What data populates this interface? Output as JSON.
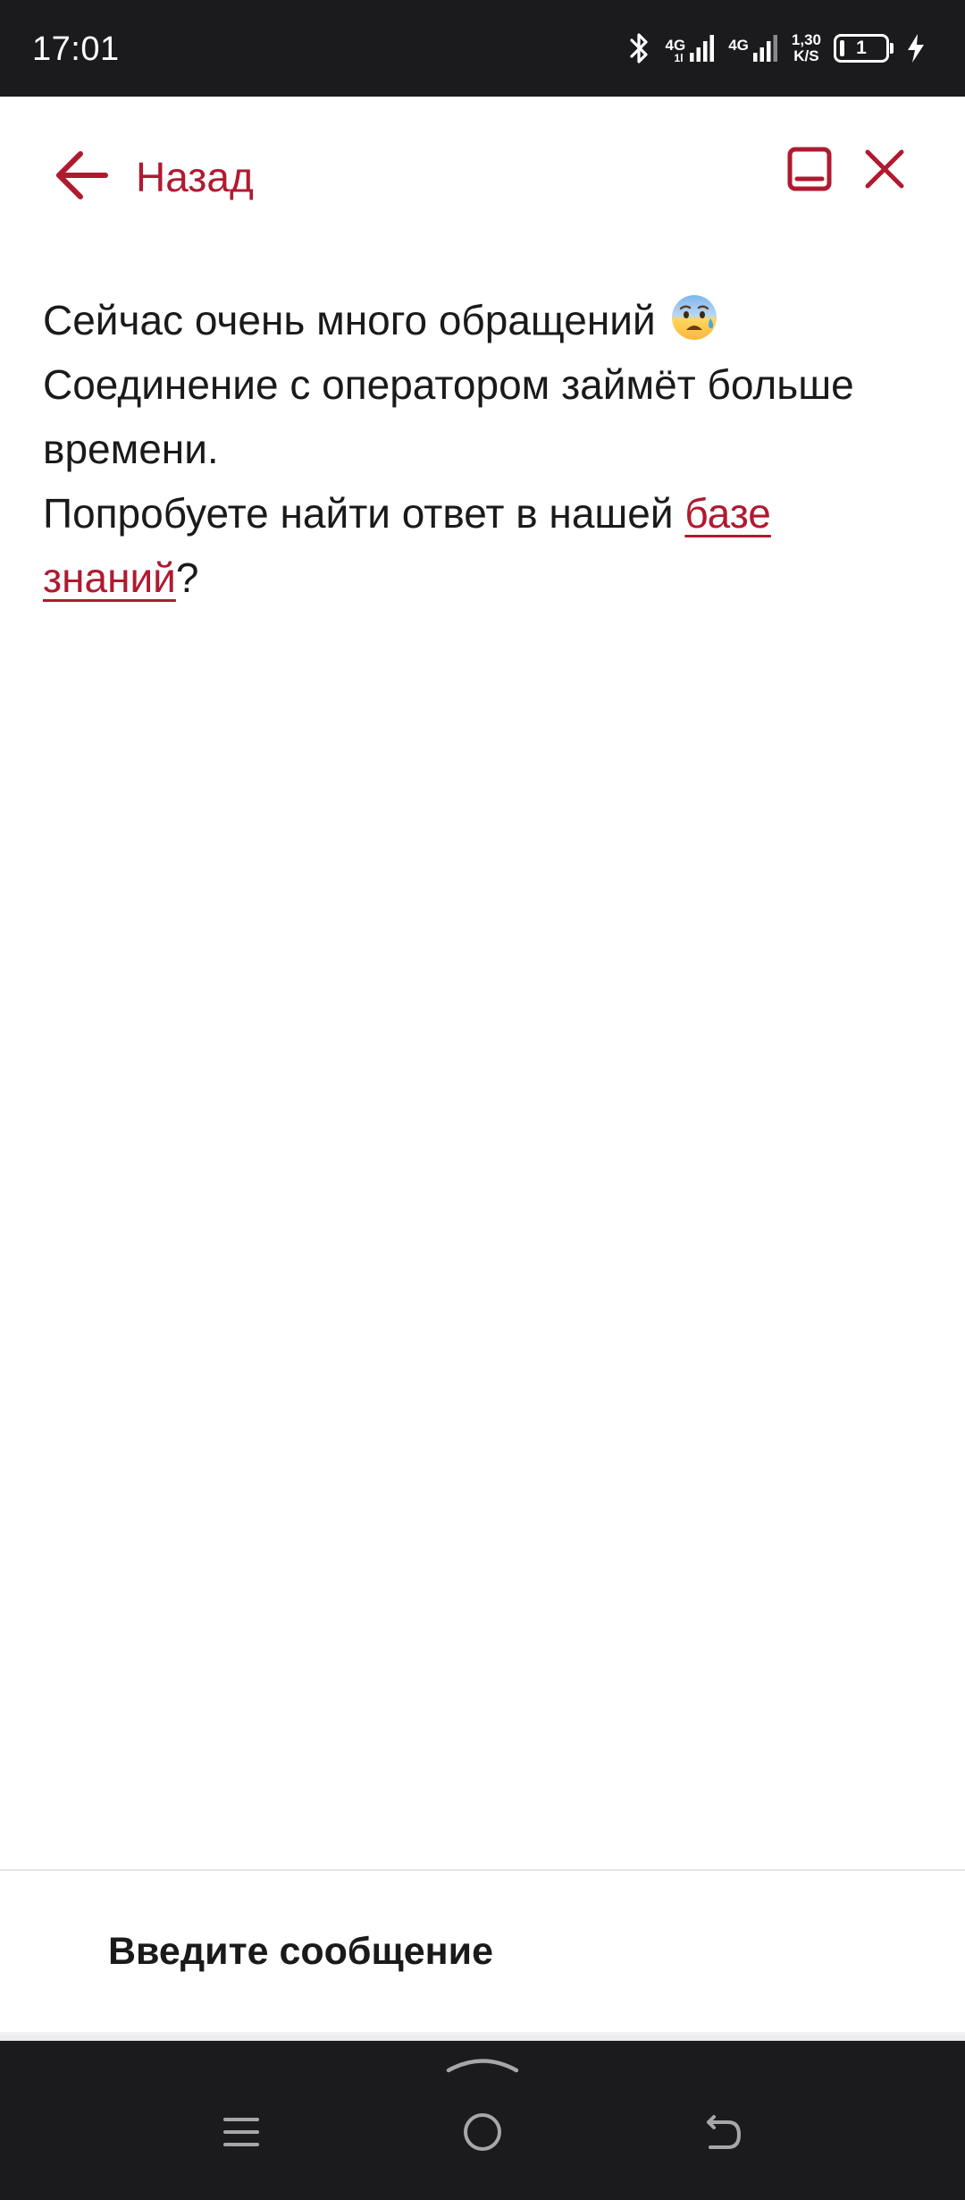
{
  "status_bar": {
    "time": "17:01",
    "network_1": "4G",
    "network_1_sub": "1l",
    "network_2": "4G",
    "speed_value": "1,30",
    "speed_unit": "K/S",
    "battery_level": "1",
    "icons": [
      "bluetooth-icon",
      "signal-icon",
      "signal-icon",
      "battery-icon",
      "charging-icon"
    ]
  },
  "header": {
    "back_label": "Назад",
    "icons": [
      "arrow-left-icon",
      "minimize-icon",
      "close-icon"
    ]
  },
  "message": {
    "line1": "Сейчас очень много обращений",
    "line1_emoji": "anxious-face-with-sweat",
    "line2": "Соединение с оператором займёт больше времени.",
    "line3_before": "Попробуете найти ответ в нашей ",
    "link_text": "базе знаний",
    "line3_after": "?"
  },
  "input": {
    "placeholder": "Введите сообщение"
  },
  "nav_bar": {
    "icons": [
      "chevron-up-icon",
      "menu-icon",
      "home-icon",
      "back-icon"
    ]
  },
  "colors": {
    "accent": "#b01a30",
    "text": "#1a1a1a",
    "system_bar": "#1b1b1d",
    "background": "#ffffff"
  }
}
